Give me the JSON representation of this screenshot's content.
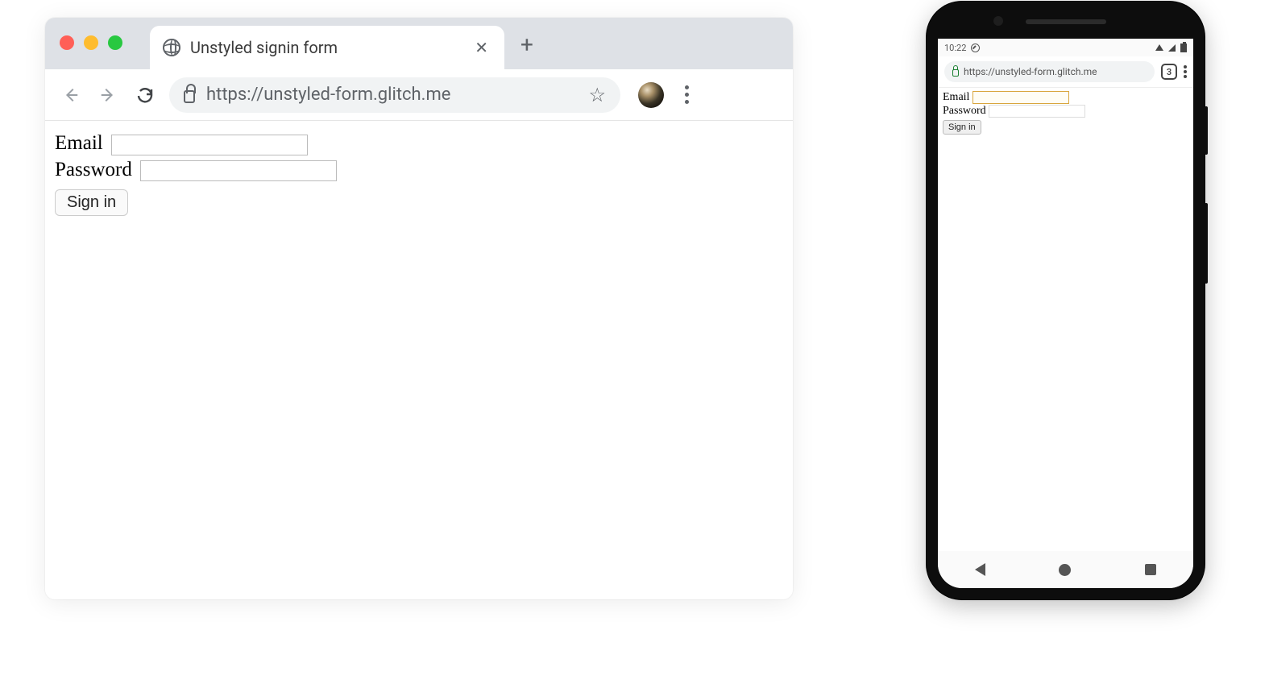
{
  "desktop": {
    "tab_title": "Unstyled signin form",
    "url": "https://unstyled-form.glitch.me",
    "form": {
      "email_label": "Email",
      "password_label": "Password",
      "submit_label": "Sign in"
    }
  },
  "phone": {
    "status_time": "10:22",
    "tab_count": "3",
    "url": "https://unstyled-form.glitch.me",
    "form": {
      "email_label": "Email",
      "password_label": "Password",
      "submit_label": "Sign in"
    }
  }
}
